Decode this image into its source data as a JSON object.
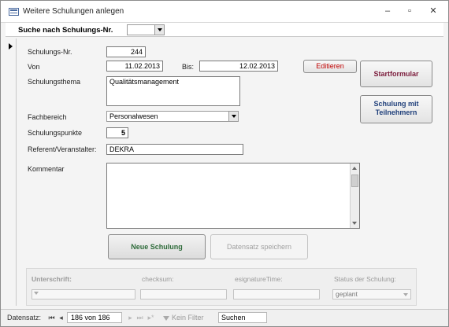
{
  "window": {
    "title": "Weitere Schulungen anlegen"
  },
  "search": {
    "label": "Suche nach Schulungs-Nr.",
    "value": ""
  },
  "form": {
    "schulungs_nr": {
      "label": "Schulungs-Nr.",
      "value": "244"
    },
    "von": {
      "label": "Von",
      "value": "11.02.2013"
    },
    "bis": {
      "label": "Bis:",
      "value": "12.02.2013"
    },
    "schulungsthema": {
      "label": "Schulungsthema",
      "value": "Qualitätsmanagement"
    },
    "fachbereich": {
      "label": "Fachbereich",
      "value": "Personalwesen"
    },
    "schulungspunkte": {
      "label": "Schulungspunkte",
      "value": "5"
    },
    "referent": {
      "label": "Referent/Veranstalter:",
      "value": "DEKRA"
    },
    "kommentar": {
      "label": "Kommentar",
      "value": ""
    }
  },
  "buttons": {
    "edit": "Editieren",
    "startformular": "Startformular",
    "teilnehmer_line1": "Schulung mit",
    "teilnehmer_line2": "Teilnehmern",
    "neue_schulung": "Neue Schulung",
    "speichern": "Datensatz speichern"
  },
  "footer": {
    "unterschrift": "Unterschrift:",
    "checksum": "checksum:",
    "signature_time": "esignatureTime:",
    "status_label": "Status der Schulung:",
    "status_value": "geplant"
  },
  "navbar": {
    "label": "Datensatz:",
    "position": "186 von 186",
    "filter": "Kein Filter",
    "search": "Suchen"
  },
  "colors": {
    "edit_text": "#c00000",
    "start_text": "#7a1a3a",
    "teilnehmer_text": "#1f3f7a",
    "neue_text": "#2e6b3a"
  }
}
